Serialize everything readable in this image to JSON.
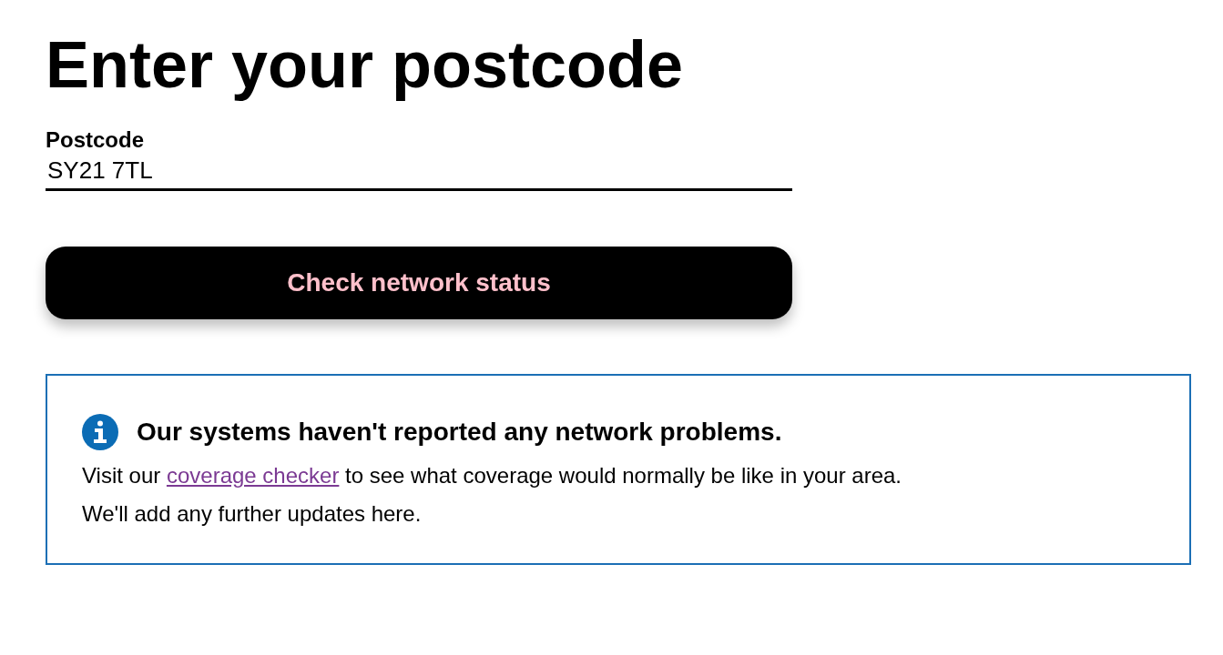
{
  "heading": "Enter your postcode",
  "postcode_field": {
    "label": "Postcode",
    "value": "SY21 7TL"
  },
  "submit_button": {
    "label": "Check network status"
  },
  "notice": {
    "title": "Our systems haven't reported any network problems.",
    "message": {
      "before": "Visit our ",
      "link": "coverage checker",
      "after": " to see what coverage would normally be like in your area."
    },
    "note": "We'll add any further updates here."
  }
}
